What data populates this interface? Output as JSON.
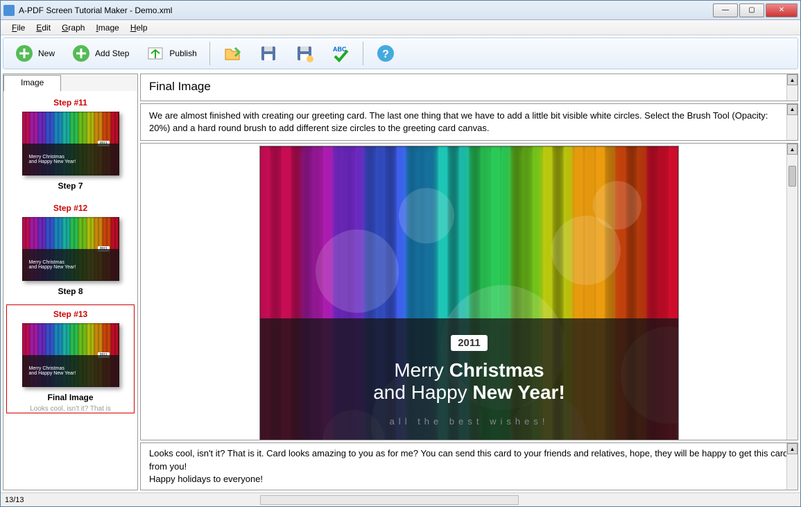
{
  "window": {
    "title": "A-PDF Screen Tutorial Maker - Demo.xml"
  },
  "menu": {
    "file": "File",
    "edit": "Edit",
    "graph": "Graph",
    "image": "Image",
    "help": "Help"
  },
  "toolbar": {
    "new": "New",
    "addstep": "Add Step",
    "publish": "Publish"
  },
  "sidebar": {
    "tab": "Image",
    "items": [
      {
        "header": "Step #11",
        "label": "Step 7"
      },
      {
        "header": "Step #12",
        "label": "Step 8"
      },
      {
        "header": "Step #13",
        "label": "Final Image",
        "desc": "Looks cool, isn't it? That is"
      }
    ]
  },
  "main": {
    "title": "Final Image",
    "desc": "We are almost finished with creating our greeting card. The last one thing that we have to add a little bit visible white circles. Select the Brush Tool (Opacity: 20%) and a hard round brush to add different size circles to the greeting card canvas.",
    "footer1": "Looks cool, isn't it? That is it. Card looks amazing to you as for me? You can send this card to your friends and relatives, hope, they will be happy to get this card from you!",
    "footer2": "Happy holidays to everyone!"
  },
  "card": {
    "year": "2011",
    "line1a": "Merry ",
    "line1b": "Christmas",
    "line2a": "and Happy ",
    "line2b": "New Year!",
    "wishes": "all the best wishes!",
    "thumb_l1": "Merry Christmas",
    "thumb_l2": "and Happy New Year!"
  },
  "status": {
    "page": "13/13"
  },
  "colors": [
    "#e01060",
    "#c020c0",
    "#8030e0",
    "#4060f0",
    "#20a0e0",
    "#20d0c0",
    "#30e060",
    "#80e020",
    "#d0e010",
    "#f0a010",
    "#f05010",
    "#e01030"
  ]
}
